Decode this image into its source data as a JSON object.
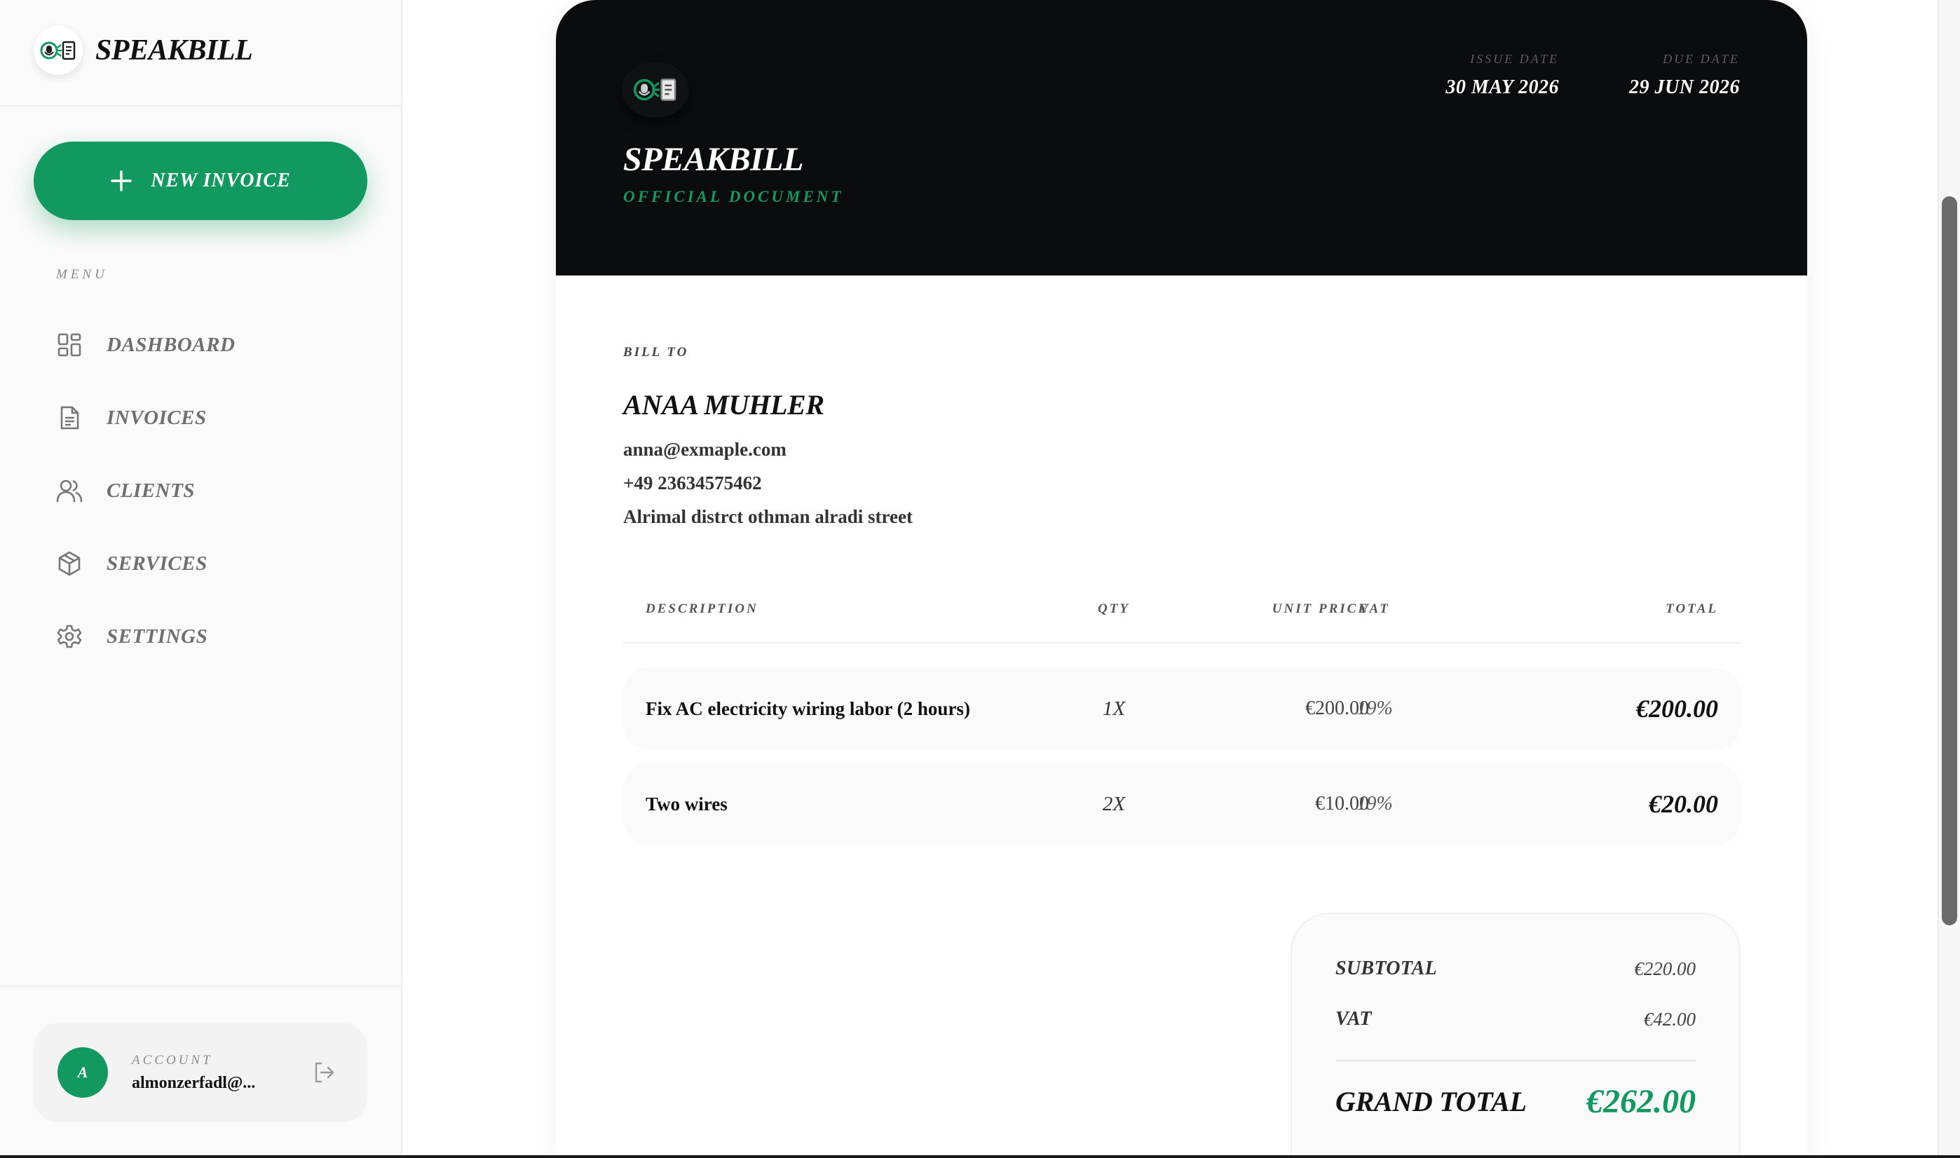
{
  "app": {
    "brand": "SPEAKBILL"
  },
  "sidebar": {
    "new_invoice_label": "NEW INVOICE",
    "menu_label": "MENU",
    "items": [
      {
        "label": "DASHBOARD",
        "icon": "dashboard-grid-icon"
      },
      {
        "label": "INVOICES",
        "icon": "document-icon"
      },
      {
        "label": "CLIENTS",
        "icon": "users-icon"
      },
      {
        "label": "SERVICES",
        "icon": "box-icon"
      },
      {
        "label": "SETTINGS",
        "icon": "gear-icon"
      }
    ],
    "account": {
      "avatar_initial": "A",
      "label": "ACCOUNT",
      "email": "almonzerfadl@..."
    }
  },
  "invoice": {
    "brand": "SPEAKBILL",
    "subtitle": "OFFICIAL DOCUMENT",
    "issue_date_label": "ISSUE DATE",
    "issue_date": "30 MAY 2026",
    "due_date_label": "DUE DATE",
    "due_date": "29 JUN 2026",
    "bill_to_label": "BILL TO",
    "client": {
      "name": "ANAA MUHLER",
      "email": "anna@exmaple.com",
      "phone": "+49 23634575462",
      "address": "Alrimal distrct othman alradi street"
    },
    "columns": {
      "description": "DESCRIPTION",
      "qty": "QTY",
      "unit_price": "UNIT PRICE",
      "vat": "VAT",
      "total": "TOTAL"
    },
    "items": [
      {
        "description": "Fix AC electricity wiring labor (2 hours)",
        "qty": "1X",
        "unit_price": "€200.00",
        "vat": "19%",
        "total": "€200.00"
      },
      {
        "description": "Two wires",
        "qty": "2X",
        "unit_price": "€10.00",
        "vat": "19%",
        "total": "€20.00"
      }
    ],
    "totals": {
      "subtotal_label": "SUBTOTAL",
      "subtotal": "€220.00",
      "vat_label": "VAT",
      "vat": "€42.00",
      "grand_total_label": "GRAND TOTAL",
      "grand_total": "€262.00"
    }
  },
  "colors": {
    "accent": "#12995f",
    "header_bg": "#0b0c0e",
    "sidebar_bg": "#fafafa"
  }
}
